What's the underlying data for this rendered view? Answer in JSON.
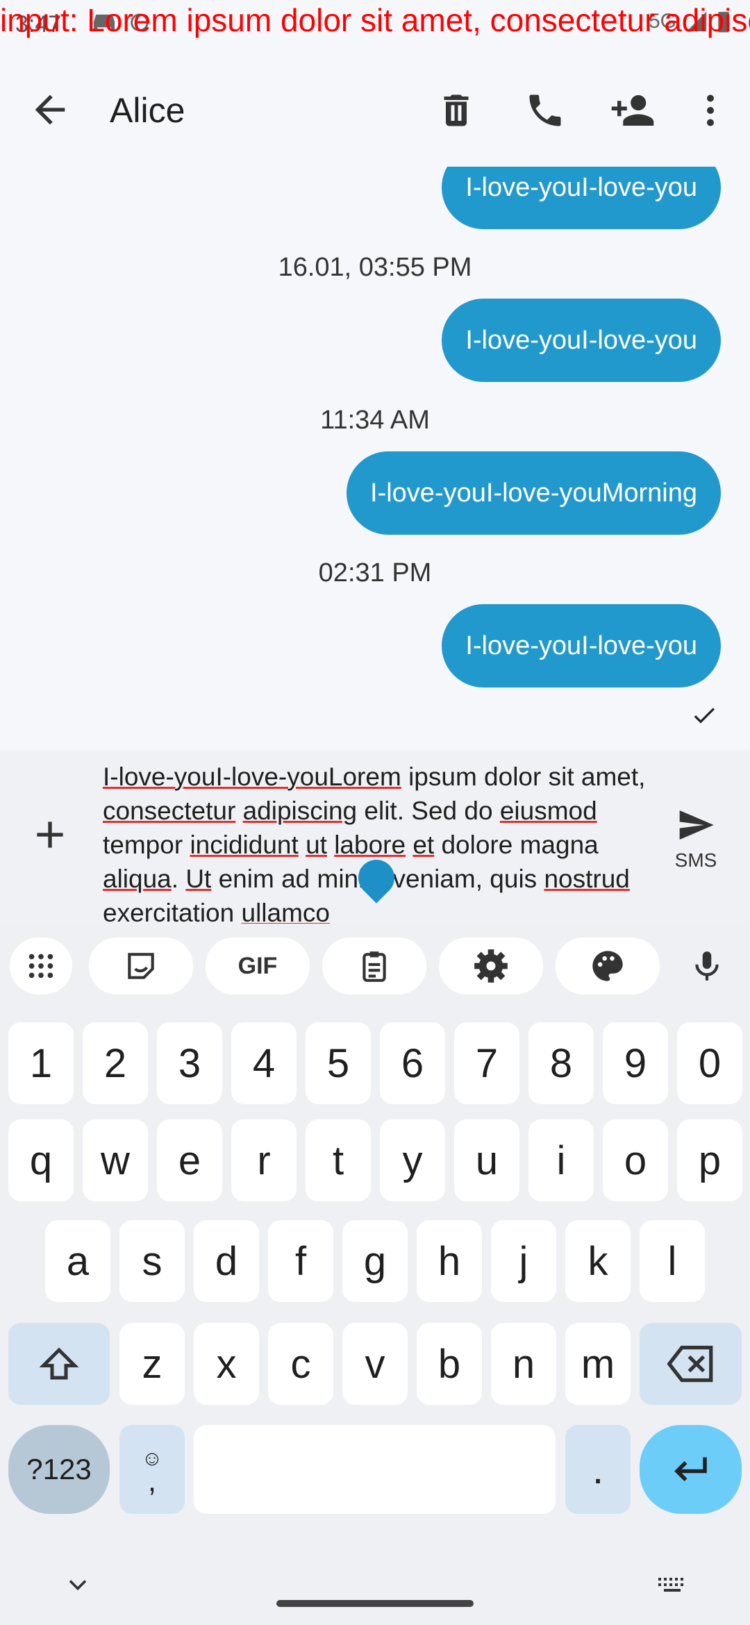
{
  "status_bar": {
    "time": "3:47",
    "debug_text": "input: Lorem ipsum dolor sit amet, consectetur adipiscing"
  },
  "appbar": {
    "title": "Alice"
  },
  "messages": [
    {
      "text": "I-love-youI-love-you"
    },
    {
      "stamp": "16.01, 03:55 PM"
    },
    {
      "text": "I-love-youI-love-you"
    },
    {
      "stamp": "11:34 AM"
    },
    {
      "text": "I-love-youI-love-youMorning"
    },
    {
      "stamp": "02:31 PM"
    },
    {
      "text": "I-love-youI-love-you"
    }
  ],
  "compose": {
    "text_parts": [
      "I-love-youI-love-youLorem",
      " ipsum dolor sit amet, ",
      "consectetur",
      " ",
      "adipiscing",
      " elit. Sed do ",
      "eiusmod",
      " tempor ",
      "incididunt",
      " ",
      "ut",
      " ",
      "labore",
      " ",
      "et",
      " dolore magna ",
      "aliqua",
      ". ",
      "Ut",
      " enim ad minim veniam, quis ",
      "nostrud",
      " exercitation ",
      "ullamco"
    ],
    "send_label": "SMS"
  },
  "keyboard": {
    "toolbar": [
      "apps-icon",
      "sticker-icon",
      "GIF",
      "clipboard-icon",
      "settings-icon",
      "palette-icon",
      "mic-icon"
    ],
    "row_numbers": [
      "1",
      "2",
      "3",
      "4",
      "5",
      "6",
      "7",
      "8",
      "9",
      "0"
    ],
    "row1": [
      "q",
      "w",
      "e",
      "r",
      "t",
      "y",
      "u",
      "i",
      "o",
      "p"
    ],
    "row2": [
      "a",
      "s",
      "d",
      "f",
      "g",
      "h",
      "j",
      "k",
      "l"
    ],
    "row3": [
      "z",
      "x",
      "c",
      "v",
      "b",
      "n",
      "m"
    ],
    "sym_label": "?123",
    "emoji_comma_label": ",",
    "period_label": "."
  },
  "colors": {
    "bubble": "#2299cc",
    "accent": "#1e90c8"
  }
}
